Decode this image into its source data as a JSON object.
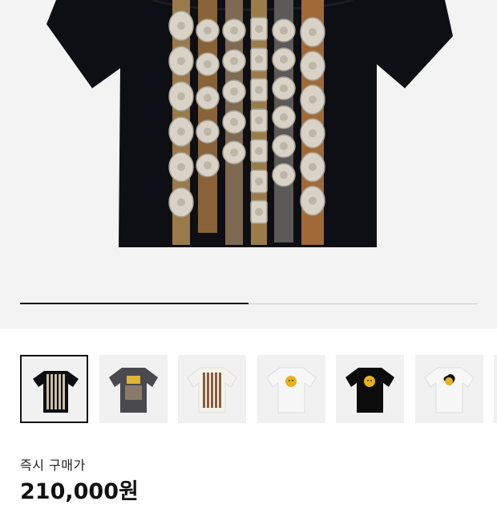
{
  "gallery": {
    "main_image": {
      "icon": "concho-belt-tshirt-black",
      "shirt_color": "#0e0f14"
    },
    "progress": 0.5,
    "thumbnails": [
      {
        "icon": "concho-belt-tshirt-black",
        "bg": "#0d0e12",
        "selected": true
      },
      {
        "icon": "graphic-tshirt-charcoal",
        "bg": "#4a4a4e",
        "selected": false
      },
      {
        "icon": "concho-belt-tshirt-white",
        "bg": "#f4f2ec",
        "selected": false
      },
      {
        "icon": "smiley-tshirt-white",
        "bg": "#f7f7f7",
        "selected": false
      },
      {
        "icon": "smiley-tshirt-black",
        "bg": "#0c0c0c",
        "selected": false
      },
      {
        "icon": "smiley-heart-tshirt-white",
        "bg": "#f7f7f7",
        "selected": false
      }
    ]
  },
  "purchase": {
    "label": "즉시 구매가",
    "price": "210,000원"
  }
}
